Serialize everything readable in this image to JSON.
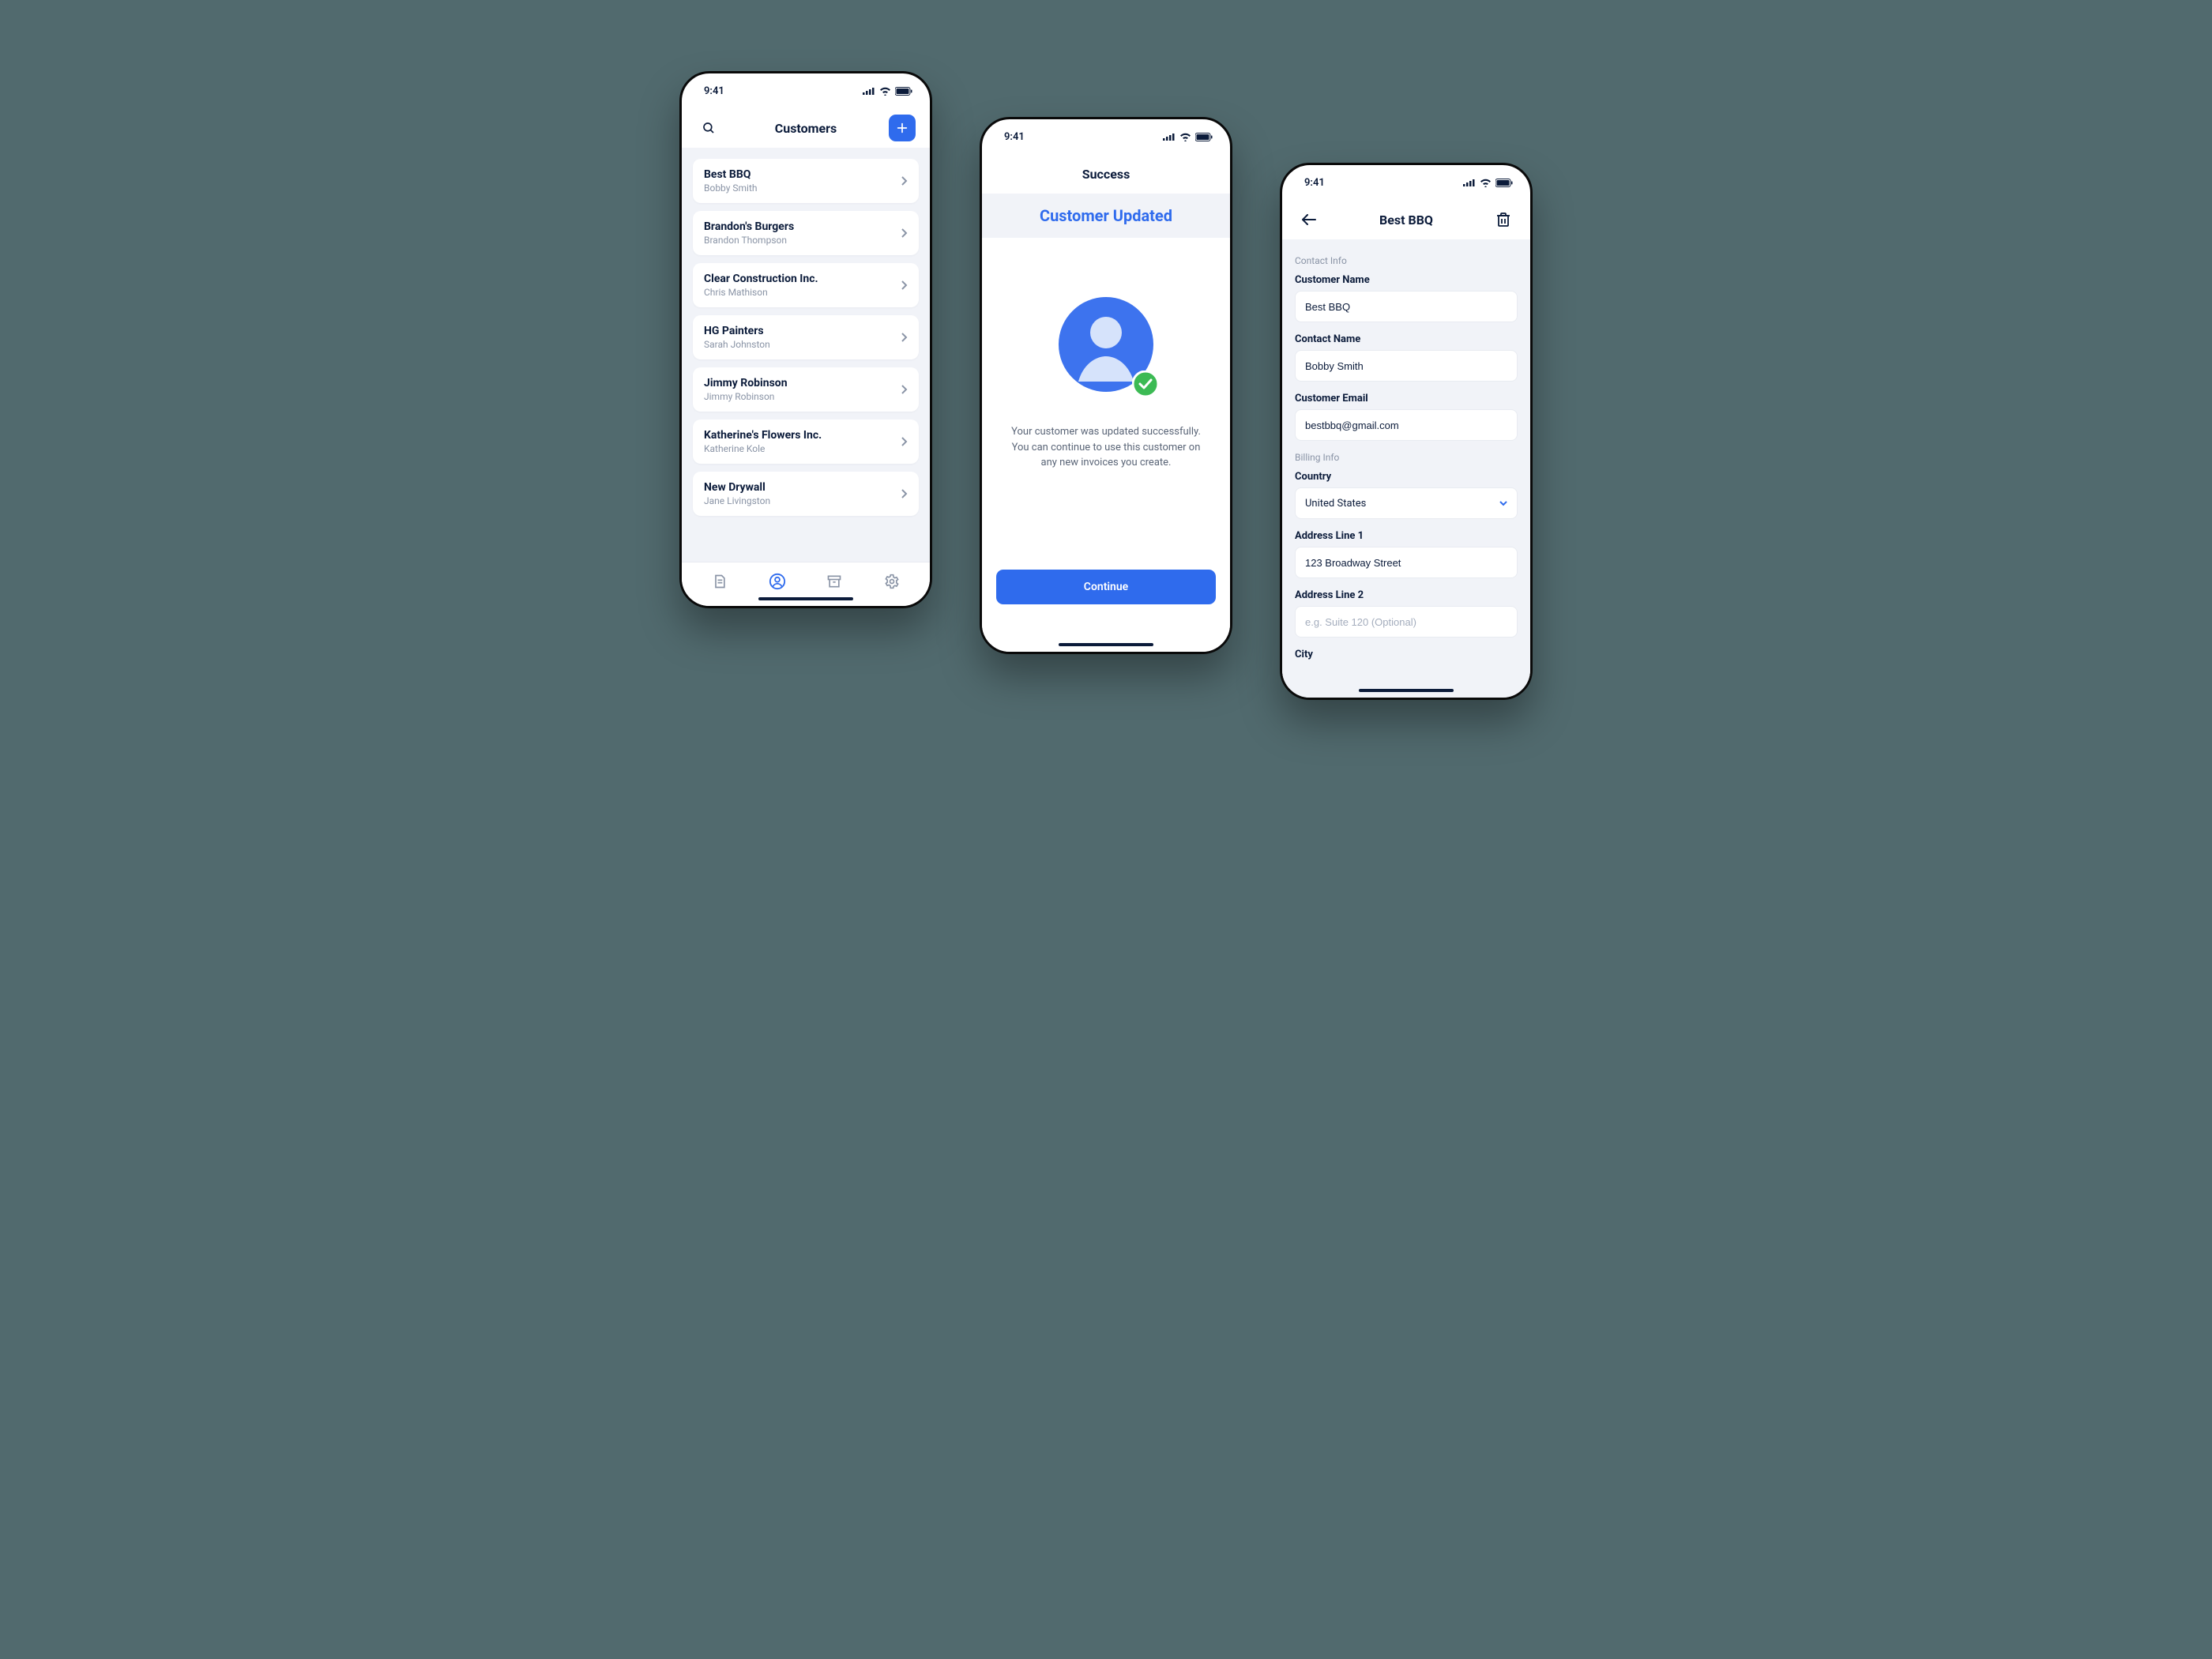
{
  "colors": {
    "accent": "#2f6bed",
    "bg": "#516a6e",
    "surface": "#f1f3f8",
    "text": "#0b1b3a",
    "muted": "#8a94a6",
    "success": "#3cba54"
  },
  "status": {
    "time": "9:41"
  },
  "screen1": {
    "title": "Customers",
    "customers": [
      {
        "name": "Best BBQ",
        "contact": "Bobby Smith"
      },
      {
        "name": "Brandon's Burgers",
        "contact": "Brandon Thompson"
      },
      {
        "name": "Clear Construction Inc.",
        "contact": "Chris Mathison"
      },
      {
        "name": "HG Painters",
        "contact": "Sarah Johnston"
      },
      {
        "name": "Jimmy Robinson",
        "contact": "Jimmy Robinson"
      },
      {
        "name": "Katherine's Flowers Inc.",
        "contact": "Katherine Kole"
      },
      {
        "name": "New Drywall",
        "contact": "Jane Livingston"
      }
    ],
    "tabs": [
      "invoices",
      "customers",
      "archive",
      "settings"
    ]
  },
  "screen2": {
    "nav_title": "Success",
    "headline": "Customer Updated",
    "message_line1": "Your customer was updated successfully.",
    "message_line2": "You can continue to use this customer on",
    "message_line3": "any new invoices you create.",
    "continue_label": "Continue"
  },
  "screen3": {
    "title": "Best BBQ",
    "sections": {
      "contact": {
        "label": "Contact Info",
        "customer_name": {
          "label": "Customer Name",
          "value": "Best BBQ"
        },
        "contact_name": {
          "label": "Contact Name",
          "value": "Bobby Smith"
        },
        "customer_email": {
          "label": "Customer Email",
          "value": "bestbbq@gmail.com"
        }
      },
      "billing": {
        "label": "Billing Info",
        "country": {
          "label": "Country",
          "value": "United States"
        },
        "address1": {
          "label": "Address Line 1",
          "value": "123 Broadway Street"
        },
        "address2": {
          "label": "Address Line 2",
          "placeholder": "e.g. Suite 120 (Optional)"
        },
        "city": {
          "label": "City"
        }
      }
    }
  }
}
